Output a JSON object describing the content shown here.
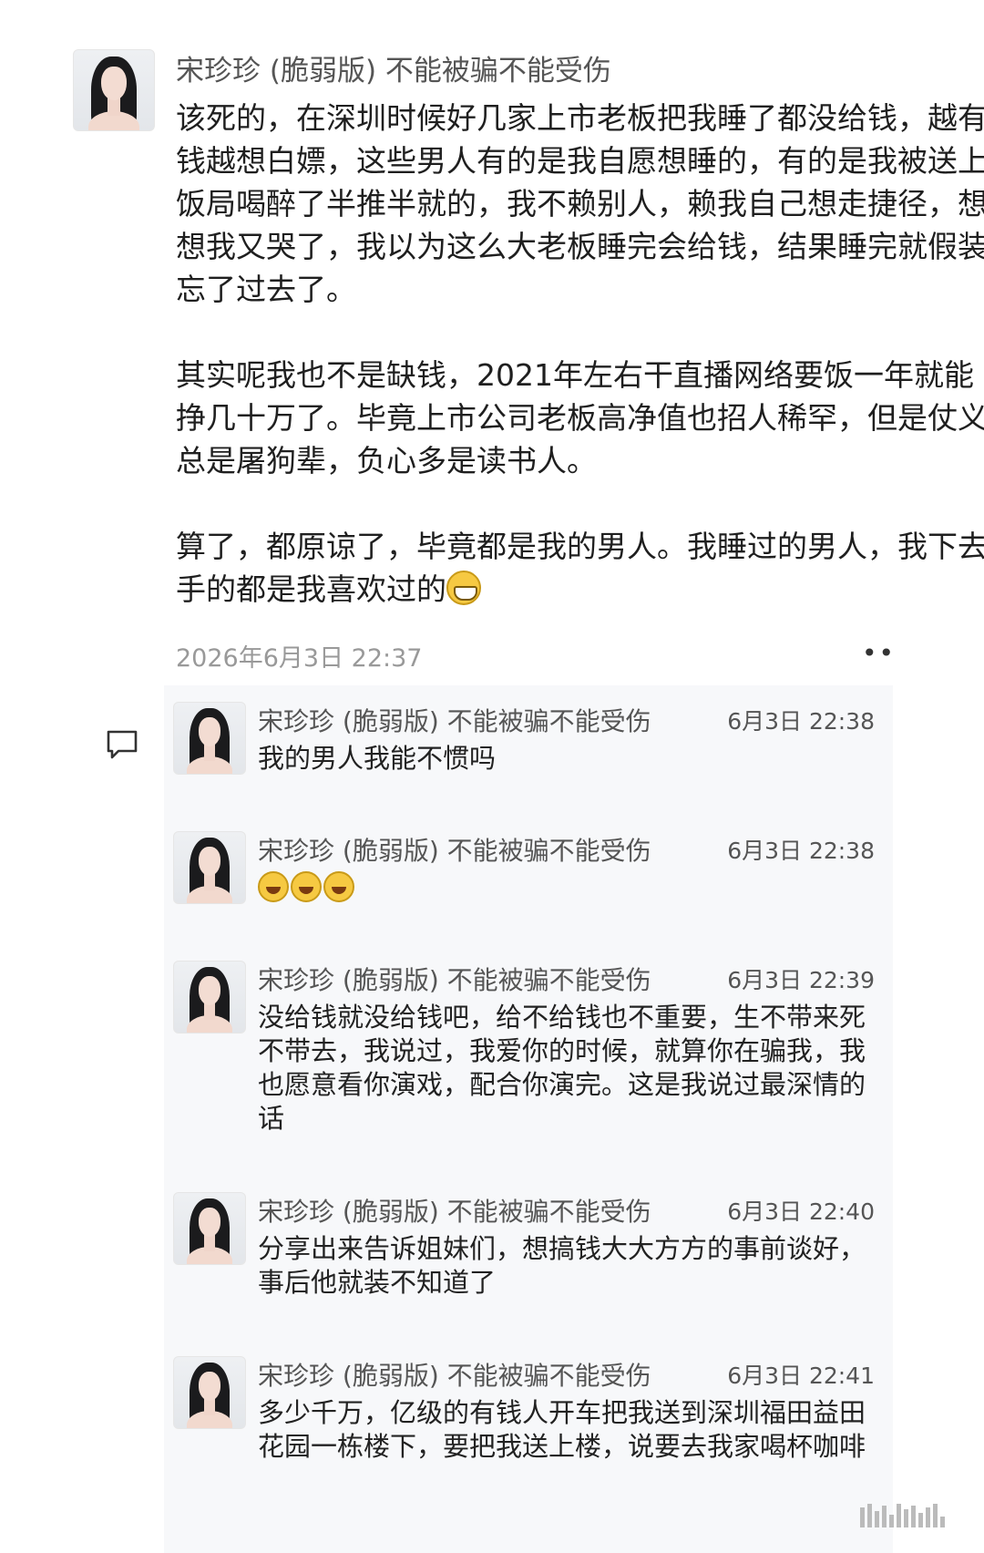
{
  "post": {
    "author": "宋珍珍 (脆弱版) 不能被骗不能受伤",
    "paragraphs": [
      "该死的，在深圳时候好几家上市老板把我睡了都没给钱，越有钱越想白嫖，这些男人有的是我自愿想睡的，有的是我被送上饭局喝醉了半推半就的，我不赖别人，赖我自己想走捷径，想想我又哭了，我以为这么大老板睡完会给钱，结果睡完就假装忘了过去了。",
      "其实呢我也不是缺钱，2021年左右干直播网络要饭一年就能挣几十万了。毕竟上市公司老板高净值也招人稀罕，但是仗义总是屠狗辈，负心多是读书人。",
      "算了，都原谅了，毕竟都是我的男人。我睡过的男人，我下去手的都是我喜欢过的"
    ],
    "emoji_icon": "grinning-face-emoji",
    "time": "2026年6月3日 22:37",
    "more_label": "••"
  },
  "comments": [
    {
      "author": "宋珍珍 (脆弱版) 不能被骗不能受伤",
      "time": "6月3日 22:38",
      "text": "我的男人我能不惯吗"
    },
    {
      "author": "宋珍珍 (脆弱版) 不能被骗不能受伤",
      "time": "6月3日 22:38",
      "text": "",
      "emoji_icons": [
        "laughing-tears-emoji",
        "laughing-tears-emoji",
        "laughing-tears-emoji"
      ]
    },
    {
      "author": "宋珍珍 (脆弱版) 不能被骗不能受伤",
      "time": "6月3日 22:39",
      "text": "没给钱就没给钱吧，给不给钱也不重要，生不带来死不带去，我说过，我爱你的时候，就算你在骗我，我也愿意看你演戏，配合你演完。这是我说过最深情的话"
    },
    {
      "author": "宋珍珍 (脆弱版) 不能被骗不能受伤",
      "time": "6月3日 22:40",
      "text": "分享出来告诉姐妹们，想搞钱大大方方的事前谈好，事后他就装不知道了"
    },
    {
      "author": "宋珍珍 (脆弱版) 不能被骗不能受伤",
      "time": "6月3日 22:41",
      "text": "多少千万，亿级的有钱人开车把我送到深圳福田益田花园一栋楼下，要把我送上楼，说要去我家喝杯咖啡"
    }
  ],
  "icons": {
    "comment": "comment-bubble-icon",
    "watermark": "barcode-watermark-icon"
  }
}
